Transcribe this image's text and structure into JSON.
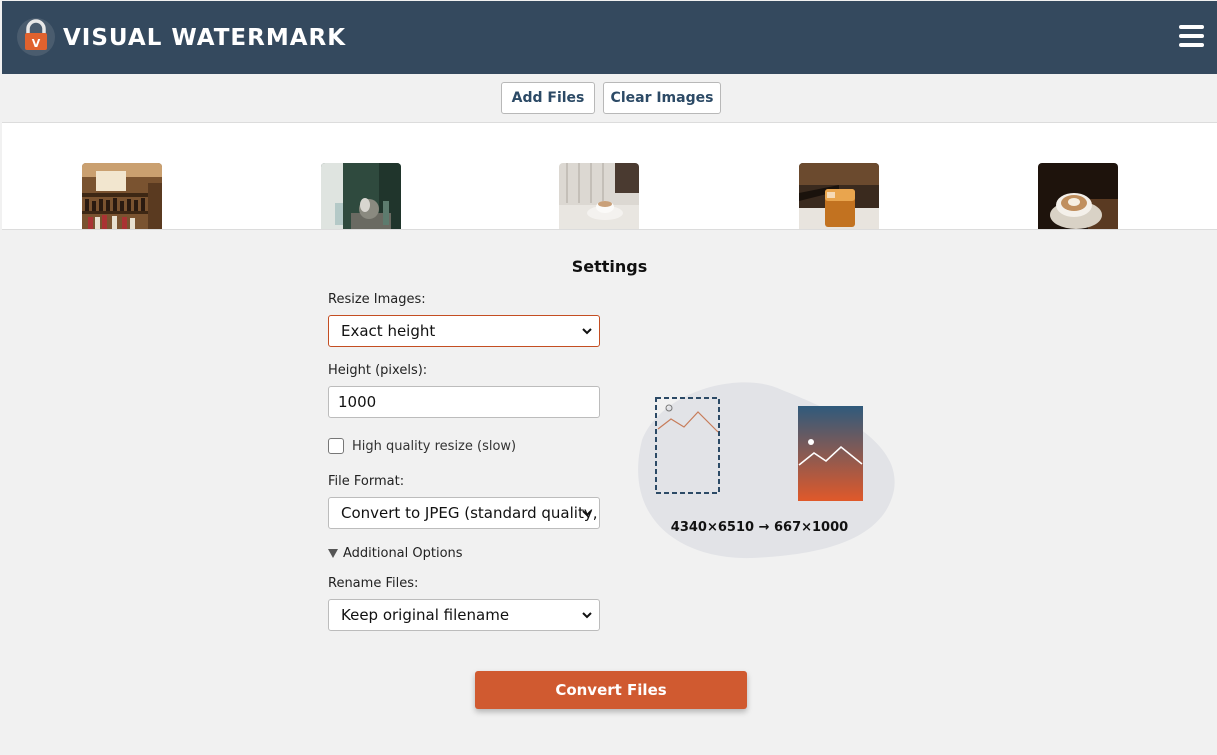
{
  "app": {
    "title": "VISUAL WATERMARK"
  },
  "toolbar": {
    "add_files": "Add Files",
    "clear_images": "Clear Images"
  },
  "thumbnails": [
    {
      "name": "thumbnail-bar-shelves"
    },
    {
      "name": "thumbnail-glassware"
    },
    {
      "name": "thumbnail-coffee-window"
    },
    {
      "name": "thumbnail-iced-drink"
    },
    {
      "name": "thumbnail-latte-beans"
    }
  ],
  "settings": {
    "title": "Settings",
    "resize_label": "Resize Images:",
    "resize_value": "Exact height",
    "height_label": "Height (pixels):",
    "height_value": "1000",
    "hq_label": "High quality resize (slow)",
    "hq_checked": false,
    "format_label": "File Format:",
    "format_value": "Convert to JPEG (standard quality, s",
    "additional_options": "Additional Options",
    "rename_label": "Rename Files:",
    "rename_value": "Keep original filename",
    "dimensions": "4340×6510 → 667×1000",
    "convert_button": "Convert Files"
  },
  "colors": {
    "header": "#34495e",
    "accent": "#d05a30",
    "toolbar_text": "#2c4a66",
    "background": "#f1f1f1"
  },
  "icons": {
    "logo": "padlock-v-logo-icon",
    "menu": "hamburger-menu-icon",
    "select_arrow": "chevron-down-icon"
  }
}
